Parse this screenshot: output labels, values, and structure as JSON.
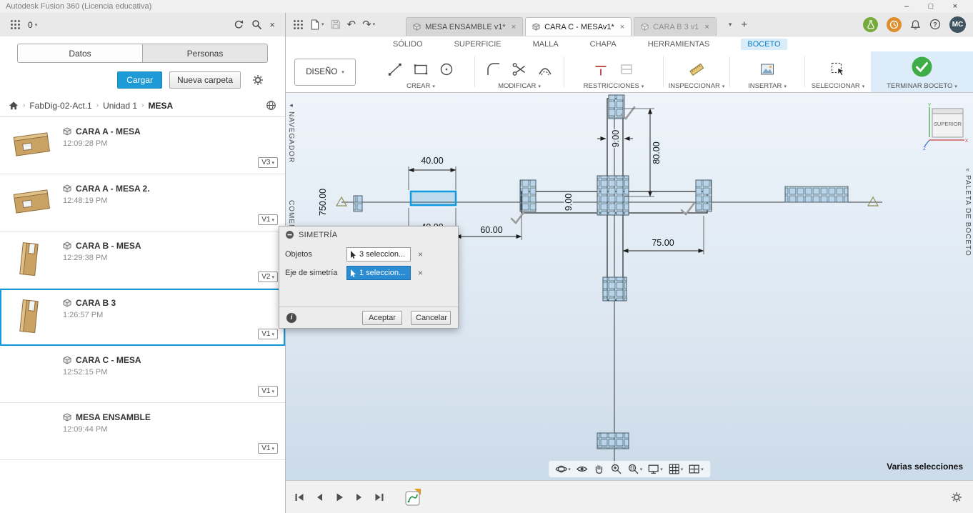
{
  "window": {
    "title": "Autodesk Fusion 360 (Licencia educativa)"
  },
  "left_panel": {
    "notification_count": "0",
    "tabs": {
      "datos": "Datos",
      "personas": "Personas"
    },
    "actions": {
      "upload": "Cargar",
      "new_folder": "Nueva carpeta"
    },
    "breadcrumb": {
      "project": "FabDig-02-Act.1",
      "folder": "Unidad 1",
      "current": "MESA"
    },
    "items": [
      {
        "name": "CARA A - MESA",
        "time": "12:09:28 PM",
        "version": "V3"
      },
      {
        "name": "CARA A - MESA 2.",
        "time": "12:48:19 PM",
        "version": "V1"
      },
      {
        "name": "CARA B - MESA",
        "time": "12:29:38 PM",
        "version": "V2"
      },
      {
        "name": "CARA B 3",
        "time": "1:26:57 PM",
        "version": "V1"
      },
      {
        "name": "CARA C - MESA",
        "time": "12:52:15 PM",
        "version": "V1"
      },
      {
        "name": "MESA ENSAMBLE",
        "time": "12:09:44 PM",
        "version": "V1"
      }
    ]
  },
  "toolbar": {
    "doc_tabs": [
      {
        "label": "MESA ENSAMBLE v1*"
      },
      {
        "label": "CARA C - MESAv1*"
      },
      {
        "label": "CARA B 3 v1"
      }
    ],
    "avatar_initials": "MC"
  },
  "ribbon": {
    "workspace": "DISEÑO",
    "tabs": [
      "SÓLIDO",
      "SUPERFICIE",
      "MALLA",
      "CHAPA",
      "HERRAMIENTAS",
      "BOCETO"
    ],
    "groups": {
      "create": "CREAR",
      "modify": "MODIFICAR",
      "constraints": "RESTRICCIONES",
      "inspect": "INSPECCIONAR",
      "insert": "INSERTAR",
      "select": "SELECCIONAR",
      "finish": "TERMINAR BOCETO"
    }
  },
  "canvas": {
    "panels": {
      "navigator": "NAVEGADOR",
      "comments": "COMEN...",
      "sketch_palette": "PALETA DE BOCETO"
    },
    "viewcube": {
      "face": "SUPERIOR",
      "axis_x": "X",
      "axis_y": "Y",
      "axis_z": "Z"
    },
    "status": "Varias selecciones",
    "dimensions": {
      "tab_width_top": "40.00",
      "overall": "750.00",
      "gap_left": "60.00",
      "tab_width_bottom": "40.00",
      "slot_width": "9.00",
      "slot_depth": "80.00",
      "gap_right": "75.00",
      "center_thickness": "9.00"
    }
  },
  "dialog": {
    "title": "SIMETRÍA",
    "objects_label": "Objetos",
    "objects_value": "3 seleccion...",
    "axis_label": "Eje de simetría",
    "axis_value": "1 seleccion...",
    "accept": "Aceptar",
    "cancel": "Cancelar"
  }
}
